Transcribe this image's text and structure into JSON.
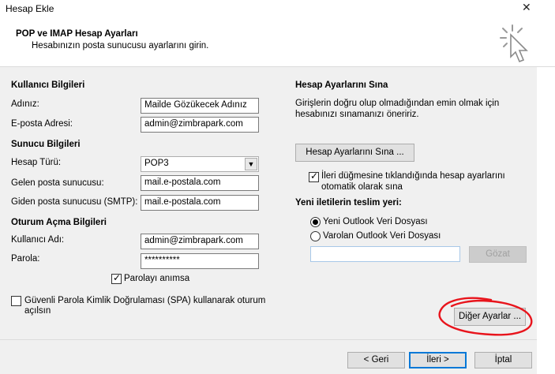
{
  "window": {
    "title": "Hesap Ekle"
  },
  "header": {
    "title": "POP ve IMAP Hesap Ayarları",
    "subtitle": "Hesabınızın posta sunucusu ayarlarını girin."
  },
  "user_info": {
    "section": "Kullanıcı Bilgileri",
    "name_label": "Adınız:",
    "name_value": "Mailde Gözükecek Adınız",
    "email_label": "E-posta Adresi:",
    "email_value": "admin@zimbrapark.com"
  },
  "server_info": {
    "section": "Sunucu Bilgileri",
    "type_label": "Hesap Türü:",
    "type_value": "POP3",
    "incoming_label": "Gelen posta sunucusu:",
    "incoming_value": "mail.e-postala.com",
    "outgoing_label": "Giden posta sunucusu (SMTP):",
    "outgoing_value": "mail.e-postala.com"
  },
  "logon_info": {
    "section": "Oturum Açma Bilgileri",
    "username_label": "Kullanıcı Adı:",
    "username_value": "admin@zimbrapark.com",
    "password_label": "Parola:",
    "password_value": "**********",
    "remember_label": "Parolayı anımsa",
    "remember_checked": true,
    "spa_label_line1": "Güvenli Parola Kimlik Doğrulaması (SPA) kullanarak oturum",
    "spa_label_line2": "açılsın",
    "spa_checked": false
  },
  "test_settings": {
    "section": "Hesap Ayarlarını Sına",
    "desc_line1": "Girişlerin doğru olup olmadığından emin olmak için",
    "desc_line2": "hesabınızı sınamanızı öneririz.",
    "test_button": "Hesap Ayarlarını Sına ...",
    "auto_test_line1": "İleri düğmesine tıklandığında hesap ayarlarını",
    "auto_test_line2": "otomatik olarak sına",
    "auto_test_checked": true
  },
  "delivery": {
    "section": "Yeni iletilerin teslim yeri:",
    "option_new": "Yeni Outlook Veri Dosyası",
    "option_existing": "Varolan Outlook Veri Dosyası",
    "selected": "new",
    "path_value": "",
    "browse_button": "Gözat"
  },
  "more_settings_button": "Diğer Ayarlar ...",
  "footer": {
    "back_button": "< Geri",
    "next_button": "İleri >",
    "cancel_button": "İptal"
  },
  "colors": {
    "annotation": "#e8141c",
    "focus_border": "#0078d7",
    "body_bg": "#f0f0f0"
  },
  "icons": {
    "close": "close-icon",
    "wizard": "cursor-click-icon",
    "select": "chevron-down-icon"
  }
}
